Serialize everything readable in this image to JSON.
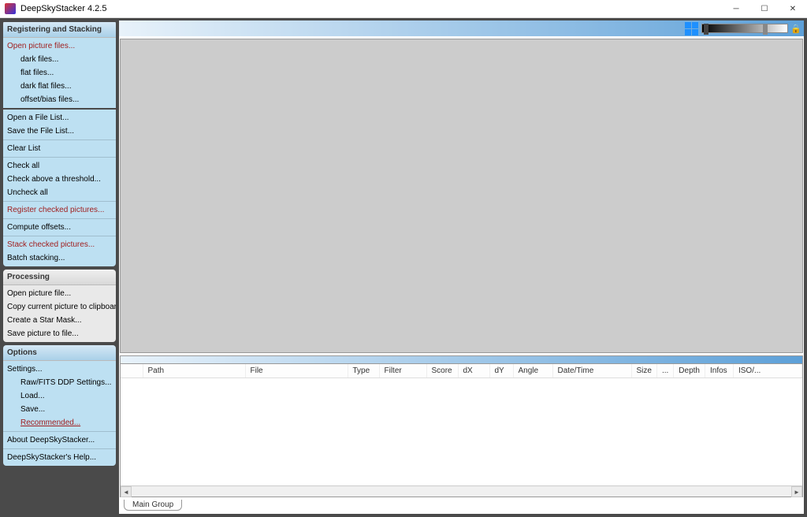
{
  "window": {
    "title": "DeepSkyStacker 4.2.5"
  },
  "sidebar": {
    "registering": {
      "header": "Registering and Stacking",
      "open_files": "Open picture files...",
      "dark_files": "dark files...",
      "flat_files": "flat files...",
      "dark_flat_files": "dark flat files...",
      "offset_bias": "offset/bias files...",
      "open_file_list": "Open a File List...",
      "save_file_list": "Save the File List...",
      "clear_list": "Clear List",
      "check_all": "Check all",
      "check_threshold": "Check above a threshold...",
      "uncheck_all": "Uncheck all",
      "register_checked": "Register checked pictures...",
      "compute_offsets": "Compute offsets...",
      "stack_checked": "Stack checked pictures...",
      "batch_stacking": "Batch stacking..."
    },
    "processing": {
      "header": "Processing",
      "open_picture": "Open picture file...",
      "copy_clipboard": "Copy current picture to clipboard",
      "create_star_mask": "Create a Star Mask...",
      "save_picture": "Save picture to file..."
    },
    "options": {
      "header": "Options",
      "settings": "Settings...",
      "raw_fits": "Raw/FITS DDP Settings...",
      "load": "Load...",
      "save": "Save...",
      "recommended": "Recommended...",
      "about": "About DeepSkyStacker...",
      "help": "DeepSkyStacker's Help..."
    }
  },
  "table": {
    "columns": [
      "",
      "Path",
      "File",
      "Type",
      "Filter",
      "Score",
      "dX",
      "dY",
      "Angle",
      "Date/Time",
      "Size",
      "...",
      "Depth",
      "Infos",
      "ISO/..."
    ]
  },
  "tabs": {
    "main_group": "Main Group"
  }
}
